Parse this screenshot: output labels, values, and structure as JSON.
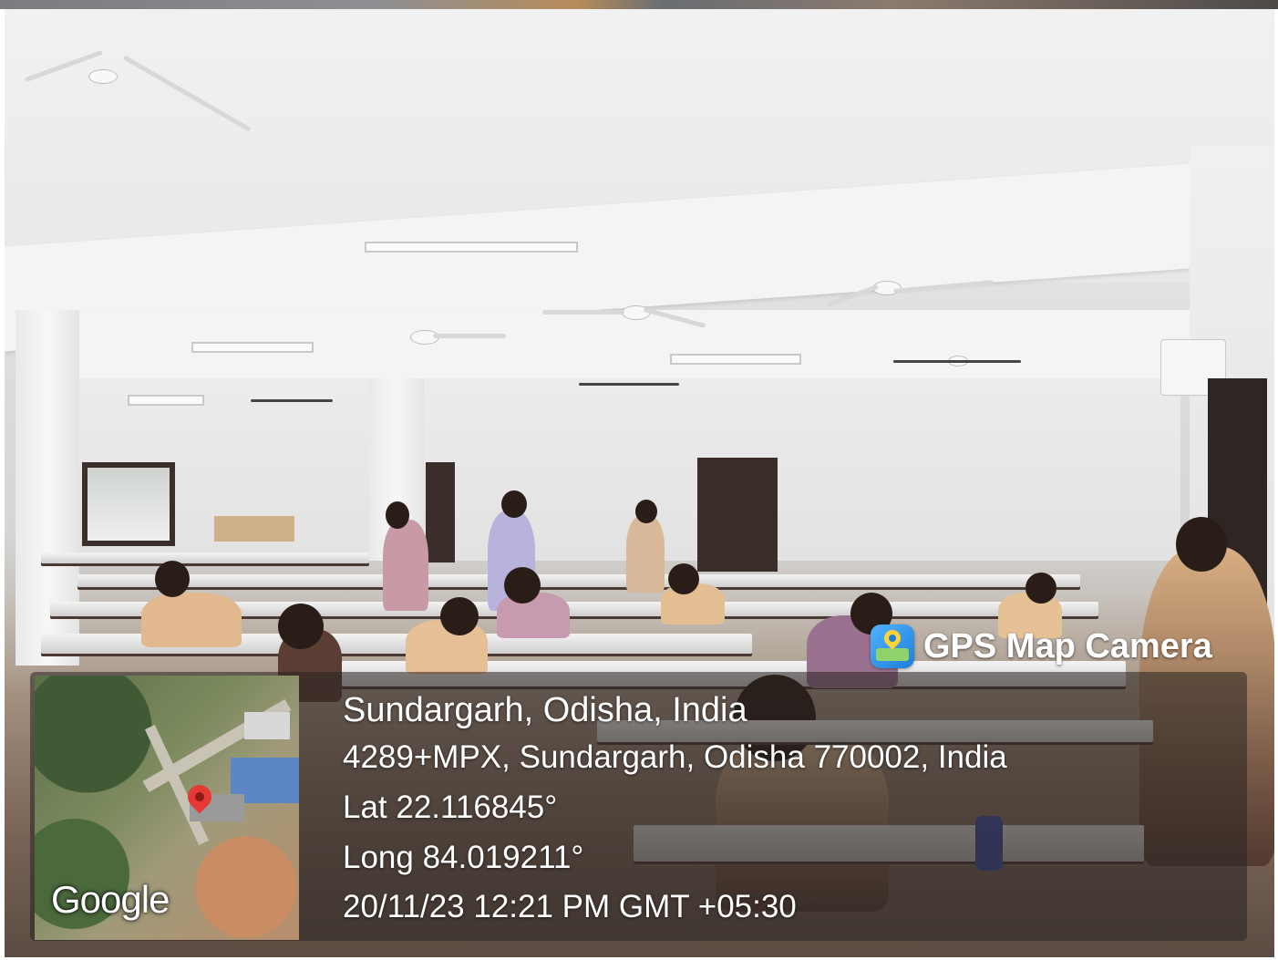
{
  "watermark": {
    "brand": "GPS Map Camera",
    "location_title": "Sundargarh, Odisha, India",
    "address": "4289+MPX, Sundargarh, Odisha 770002, India",
    "latitude": "Lat 22.116845°",
    "longitude": "Long 84.019211°",
    "datetime": "20/11/23 12:21 PM GMT +05:30"
  },
  "map": {
    "provider_logo": "Google",
    "marker_icon": "map-pin-icon",
    "marker_color": "#e53935"
  },
  "brand_icon": "gps-map-camera-icon"
}
